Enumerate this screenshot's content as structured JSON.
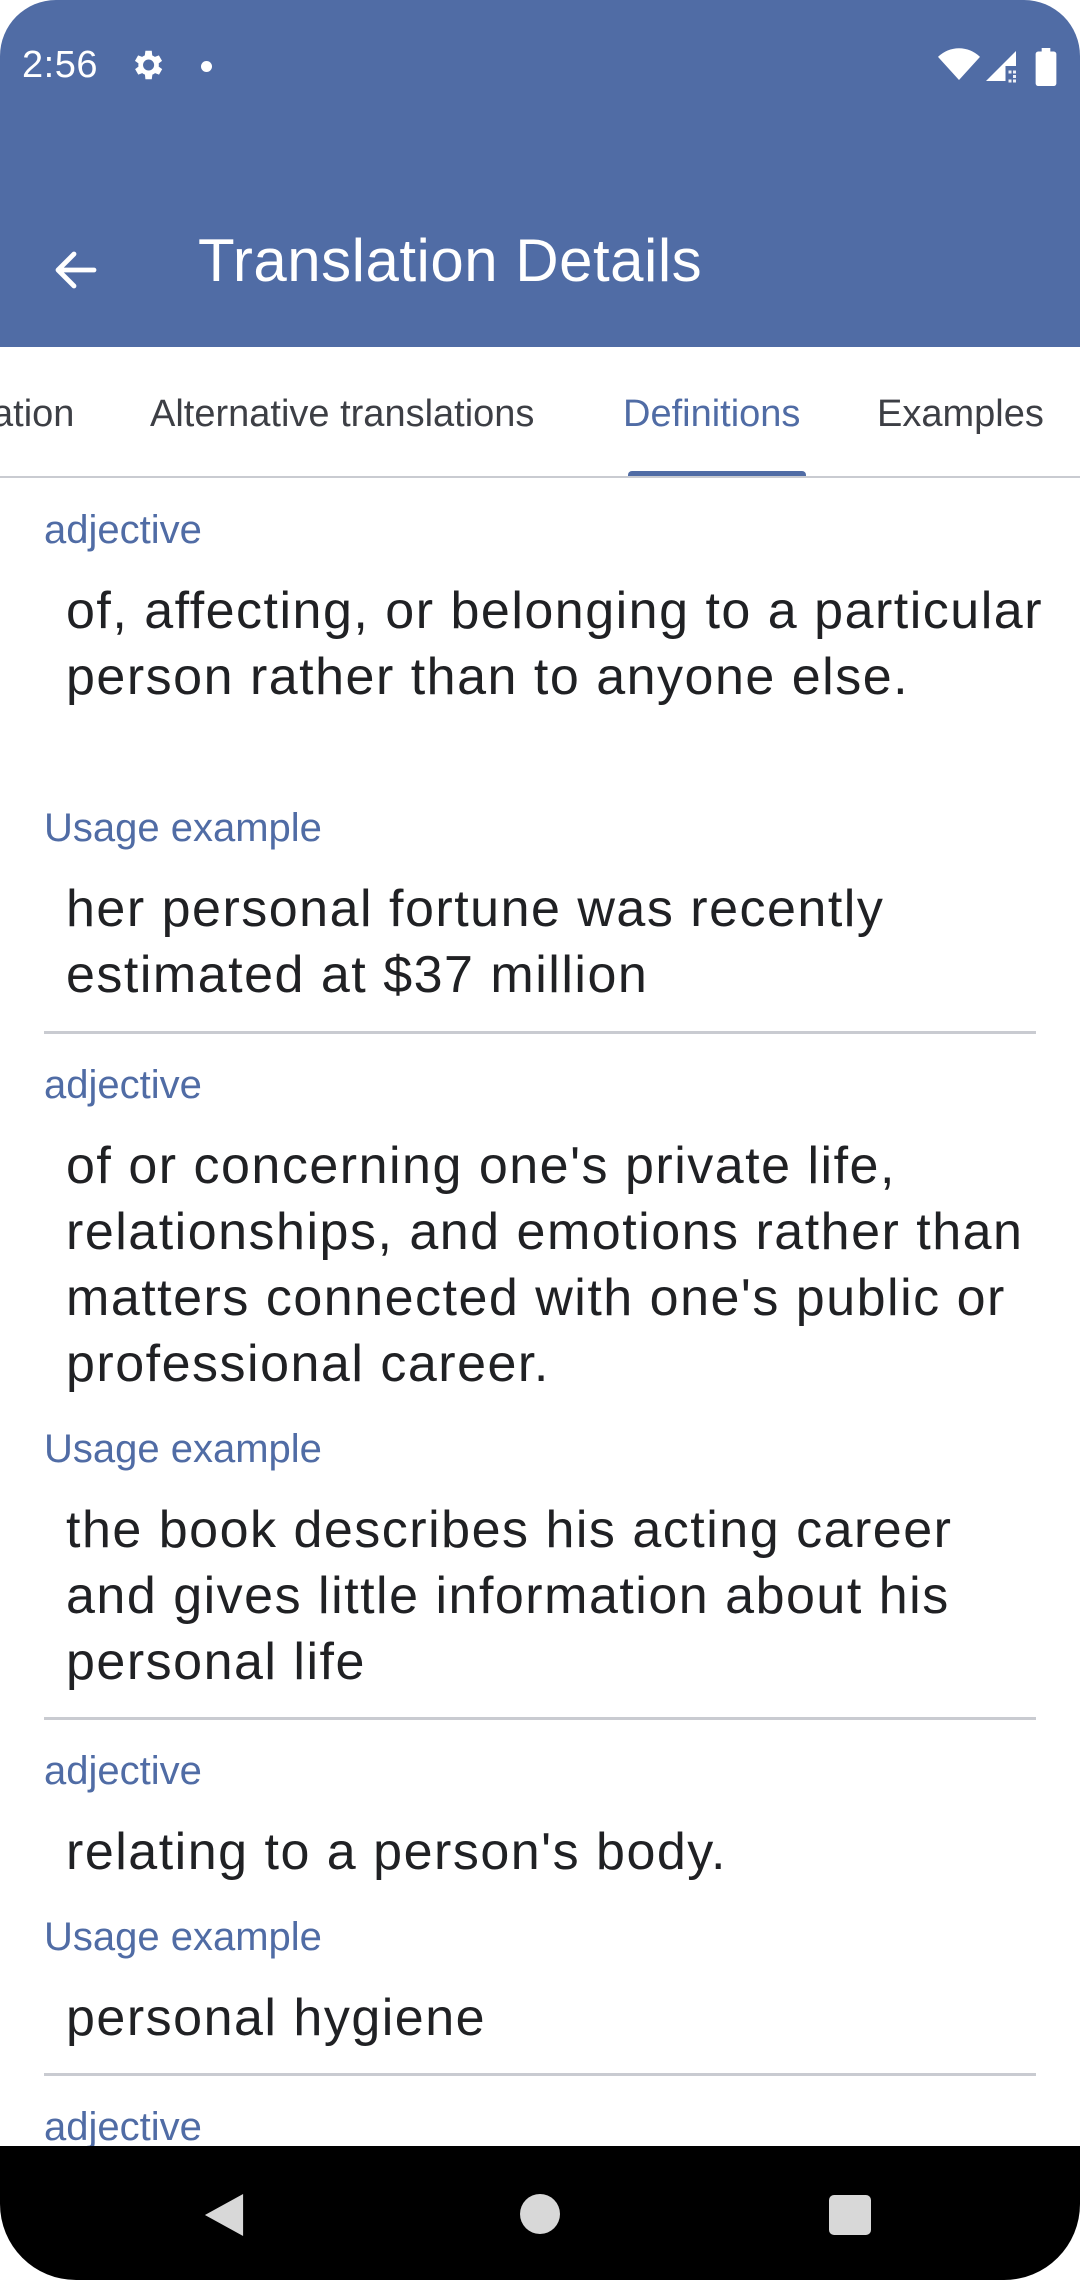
{
  "status_bar": {
    "time": "2:56",
    "icons": [
      "gear-icon",
      "notification-dot-icon",
      "wifi-icon",
      "signal-icon",
      "battery-icon"
    ]
  },
  "app_bar": {
    "title": "Translation Details",
    "back_icon": "arrow-left-icon"
  },
  "tabs": [
    {
      "label": "ation"
    },
    {
      "label": "Alternative translations"
    },
    {
      "label": "Definitions"
    },
    {
      "label": "Examples"
    }
  ],
  "active_tab": "Definitions",
  "definitions": [
    {
      "part_of_speech": "adjective",
      "definition": "of, affecting, or belonging to a particular person rather than to anyone else.",
      "usage_label": "Usage example",
      "example": "her personal fortune was recently estimated at $37 million"
    },
    {
      "part_of_speech": "adjective",
      "definition": "of or concerning one's private life, relationships, and emotions rather than matters connected with one's public or professional career.",
      "usage_label": "Usage example",
      "example": "the book describes his acting career and gives little information about his personal life"
    },
    {
      "part_of_speech": "adjective",
      "definition": "relating to a person's body.",
      "usage_label": "Usage example",
      "example": "personal hygiene"
    },
    {
      "part_of_speech": "adjective"
    }
  ],
  "colors": {
    "primary": "#506ca5",
    "text": "#202124",
    "divider": "#c9cbd1"
  },
  "navigation": {
    "icons": [
      "nav-back-icon",
      "nav-home-icon",
      "nav-recents-icon"
    ]
  }
}
